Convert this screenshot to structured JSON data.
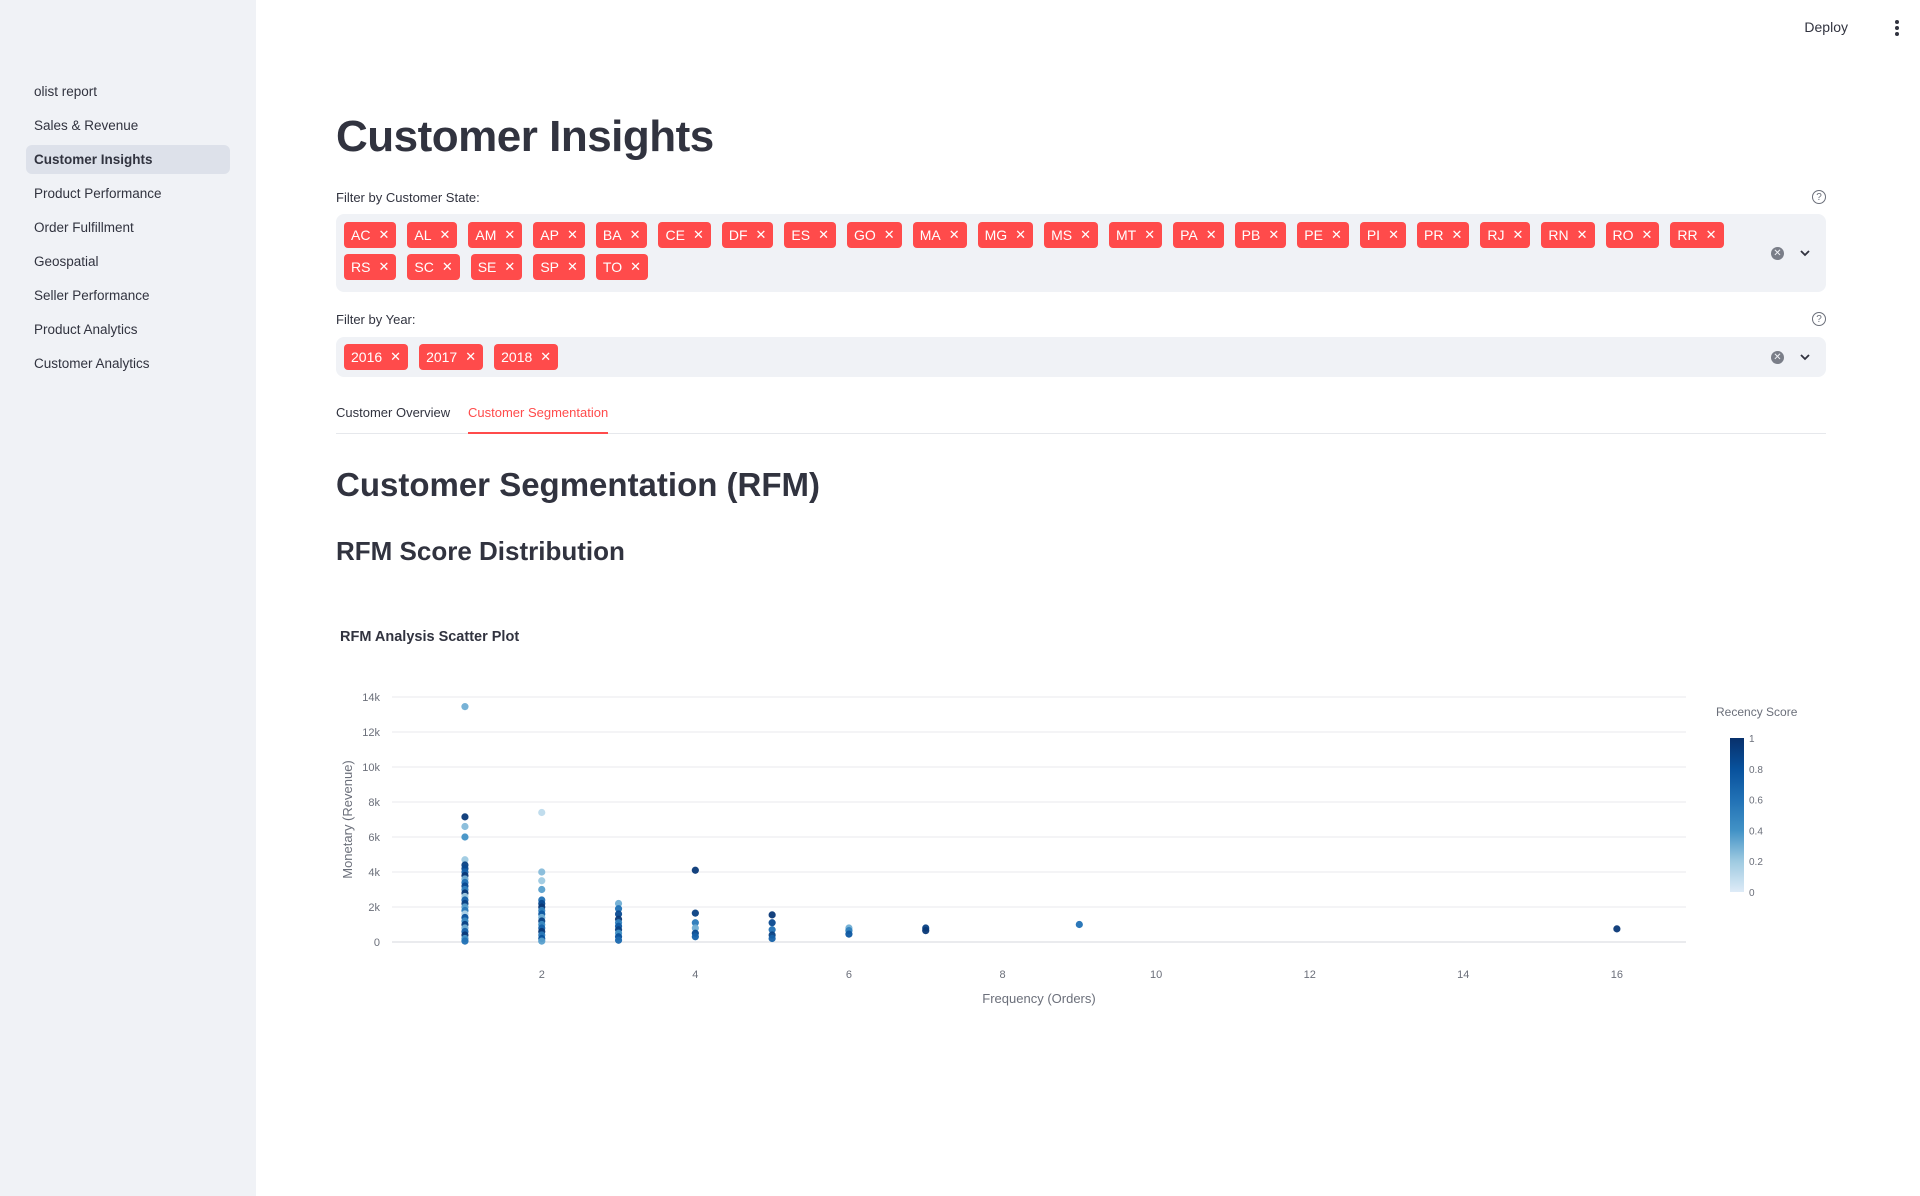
{
  "sidebar": {
    "items": [
      {
        "label": "olist report"
      },
      {
        "label": "Sales & Revenue"
      },
      {
        "label": "Customer Insights"
      },
      {
        "label": "Product Performance"
      },
      {
        "label": "Order Fulfillment"
      },
      {
        "label": "Geospatial"
      },
      {
        "label": "Seller Performance"
      },
      {
        "label": "Product Analytics"
      },
      {
        "label": "Customer Analytics"
      }
    ],
    "active_index": 2
  },
  "header": {
    "deploy_label": "Deploy"
  },
  "page": {
    "title": "Customer Insights"
  },
  "filters": {
    "state": {
      "label": "Filter by Customer State:",
      "tags": [
        "AC",
        "AL",
        "AM",
        "AP",
        "BA",
        "CE",
        "DF",
        "ES",
        "GO",
        "MA",
        "MG",
        "MS",
        "MT",
        "PA",
        "PB",
        "PE",
        "PI",
        "PR",
        "RJ",
        "RN",
        "RO",
        "RR",
        "RS",
        "SC",
        "SE",
        "SP",
        "TO"
      ]
    },
    "year": {
      "label": "Filter by Year:",
      "tags": [
        "2016",
        "2017",
        "2018"
      ]
    }
  },
  "tabs": [
    {
      "label": "Customer Overview",
      "active": false
    },
    {
      "label": "Customer Segmentation",
      "active": true
    }
  ],
  "section": {
    "heading": "Customer Segmentation (RFM)",
    "subheading": "RFM Score Distribution"
  },
  "colors": {
    "accent": "#ff4b4b",
    "tag_bg": "#ff4b4b",
    "sidebar_bg": "#f0f2f6"
  },
  "chart_data": {
    "type": "scatter",
    "title": "RFM Analysis Scatter Plot",
    "xlabel": "Frequency (Orders)",
    "ylabel": "Monetary (Revenue)",
    "xlim": [
      0.05,
      16.9
    ],
    "ylim": [
      0,
      14000
    ],
    "xticks": [
      2,
      4,
      6,
      8,
      10,
      12,
      14,
      16
    ],
    "yticks": [
      0,
      2000,
      4000,
      6000,
      8000,
      10000,
      12000,
      14000
    ],
    "ytick_labels": [
      "0",
      "2k",
      "4k",
      "6k",
      "8k",
      "10k",
      "12k",
      "14k"
    ],
    "grid": true,
    "colorbar": {
      "title": "Recency Score",
      "range": [
        0,
        1
      ],
      "ticks": [
        0,
        0.2,
        0.4,
        0.6,
        0.8,
        1
      ],
      "colorscale": [
        "#deebf7",
        "#9ecae1",
        "#4292c6",
        "#2171b5",
        "#08519c",
        "#08306b"
      ]
    },
    "points": [
      {
        "x": 1,
        "y": 13450,
        "c": 0.3
      },
      {
        "x": 1,
        "y": 7150,
        "c": 0.95
      },
      {
        "x": 1,
        "y": 6600,
        "c": 0.25
      },
      {
        "x": 1,
        "y": 6000,
        "c": 0.4
      },
      {
        "x": 1,
        "y": 4700,
        "c": 0.2
      },
      {
        "x": 1,
        "y": 4400,
        "c": 0.9
      },
      {
        "x": 1,
        "y": 4200,
        "c": 0.85
      },
      {
        "x": 1,
        "y": 4000,
        "c": 0.7
      },
      {
        "x": 1,
        "y": 3800,
        "c": 0.95
      },
      {
        "x": 1,
        "y": 3600,
        "c": 0.3
      },
      {
        "x": 1,
        "y": 3400,
        "c": 0.6
      },
      {
        "x": 1,
        "y": 3200,
        "c": 0.85
      },
      {
        "x": 1,
        "y": 3000,
        "c": 0.5
      },
      {
        "x": 1,
        "y": 2800,
        "c": 0.95
      },
      {
        "x": 1,
        "y": 2600,
        "c": 0.2
      },
      {
        "x": 1,
        "y": 2400,
        "c": 0.7
      },
      {
        "x": 1,
        "y": 2200,
        "c": 0.9
      },
      {
        "x": 1,
        "y": 2000,
        "c": 0.35
      },
      {
        "x": 1,
        "y": 1800,
        "c": 0.55
      },
      {
        "x": 1,
        "y": 1600,
        "c": 0.15
      },
      {
        "x": 1,
        "y": 1400,
        "c": 0.8
      },
      {
        "x": 1,
        "y": 1200,
        "c": 0.45
      },
      {
        "x": 1,
        "y": 1000,
        "c": 0.9
      },
      {
        "x": 1,
        "y": 800,
        "c": 0.3
      },
      {
        "x": 1,
        "y": 600,
        "c": 0.7
      },
      {
        "x": 1,
        "y": 400,
        "c": 0.95
      },
      {
        "x": 1,
        "y": 200,
        "c": 0.4
      },
      {
        "x": 1,
        "y": 50,
        "c": 0.6
      },
      {
        "x": 2,
        "y": 7400,
        "c": 0.1
      },
      {
        "x": 2,
        "y": 4000,
        "c": 0.25
      },
      {
        "x": 2,
        "y": 3500,
        "c": 0.2
      },
      {
        "x": 2,
        "y": 3000,
        "c": 0.35
      },
      {
        "x": 2,
        "y": 2400,
        "c": 0.6
      },
      {
        "x": 2,
        "y": 2200,
        "c": 0.85
      },
      {
        "x": 2,
        "y": 2000,
        "c": 0.95
      },
      {
        "x": 2,
        "y": 1800,
        "c": 0.5
      },
      {
        "x": 2,
        "y": 1600,
        "c": 0.75
      },
      {
        "x": 2,
        "y": 1400,
        "c": 0.3
      },
      {
        "x": 2,
        "y": 1200,
        "c": 0.9
      },
      {
        "x": 2,
        "y": 1000,
        "c": 0.45
      },
      {
        "x": 2,
        "y": 800,
        "c": 0.7
      },
      {
        "x": 2,
        "y": 600,
        "c": 0.95
      },
      {
        "x": 2,
        "y": 400,
        "c": 0.55
      },
      {
        "x": 2,
        "y": 200,
        "c": 0.8
      },
      {
        "x": 2,
        "y": 50,
        "c": 0.35
      },
      {
        "x": 3,
        "y": 2200,
        "c": 0.3
      },
      {
        "x": 3,
        "y": 1900,
        "c": 0.6
      },
      {
        "x": 3,
        "y": 1600,
        "c": 0.85
      },
      {
        "x": 3,
        "y": 1300,
        "c": 0.95
      },
      {
        "x": 3,
        "y": 1100,
        "c": 0.5
      },
      {
        "x": 3,
        "y": 900,
        "c": 0.75
      },
      {
        "x": 3,
        "y": 700,
        "c": 0.9
      },
      {
        "x": 3,
        "y": 500,
        "c": 0.4
      },
      {
        "x": 3,
        "y": 300,
        "c": 0.8
      },
      {
        "x": 3,
        "y": 100,
        "c": 0.65
      },
      {
        "x": 4,
        "y": 4100,
        "c": 0.95
      },
      {
        "x": 4,
        "y": 1650,
        "c": 0.9
      },
      {
        "x": 4,
        "y": 1100,
        "c": 0.55
      },
      {
        "x": 4,
        "y": 800,
        "c": 0.3
      },
      {
        "x": 4,
        "y": 500,
        "c": 0.85
      },
      {
        "x": 4,
        "y": 300,
        "c": 0.7
      },
      {
        "x": 5,
        "y": 1550,
        "c": 0.95
      },
      {
        "x": 5,
        "y": 1100,
        "c": 0.85
      },
      {
        "x": 5,
        "y": 700,
        "c": 0.6
      },
      {
        "x": 5,
        "y": 400,
        "c": 0.9
      },
      {
        "x": 5,
        "y": 200,
        "c": 0.7
      },
      {
        "x": 6,
        "y": 800,
        "c": 0.3
      },
      {
        "x": 6,
        "y": 650,
        "c": 0.5
      },
      {
        "x": 6,
        "y": 450,
        "c": 0.75
      },
      {
        "x": 7,
        "y": 800,
        "c": 0.9
      },
      {
        "x": 7,
        "y": 650,
        "c": 0.95
      },
      {
        "x": 9,
        "y": 1000,
        "c": 0.6
      },
      {
        "x": 16,
        "y": 750,
        "c": 0.95
      }
    ]
  }
}
